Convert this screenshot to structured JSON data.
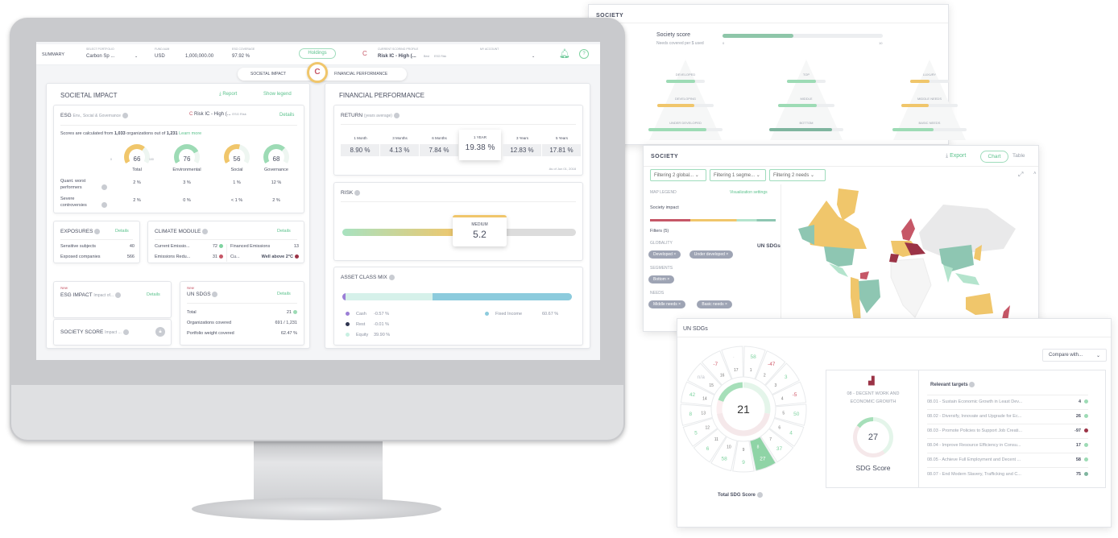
{
  "colors": {
    "accent": "#5cc28d",
    "yellow": "#f0c66b",
    "red": "#c65767",
    "darkred": "#9b3346",
    "teal": "#8ec6b2",
    "blue": "#8ccbdd"
  },
  "header": {
    "summary": "SUMMARY",
    "portfolio_label": "SELECT PORTFOLIO",
    "portfolio_value": "Carbon Sp ...",
    "aum_label": "FUND AUM",
    "aum_currency": "USD",
    "aum_value": "1,000,000.00",
    "coverage_label": "ESG COVERAGE",
    "coverage_value": "97.92 %",
    "holdings": "Holdings",
    "profile_label": "CURRENT SCORING PROFILE",
    "profile_value": "Risk IC - High (...",
    "profile_tag1": "Best",
    "profile_tag2": "ESG Risk",
    "account_label": "MY ACCOUNT"
  },
  "toggle": {
    "left": "SOCIETAL IMPACT",
    "right": "FINANCIAL PERFORMANCE",
    "logo": "C"
  },
  "societal": {
    "title": "SOCIETAL IMPACT",
    "report": "Report",
    "legend": "Show legend",
    "esg": {
      "title": "ESG",
      "subtitle": "Env., Social & Governance",
      "profile": "Risk IC - High (...",
      "tag": "ESG Risk",
      "details": "Details",
      "note_pre": "Scores are calculated from ",
      "note_n": "1,033",
      "note_mid": " organizations out of ",
      "note_total": "1,231",
      "learn": "Learn more",
      "gauges": [
        {
          "label": "Total",
          "value": 66,
          "min": "0",
          "max": "100",
          "color": "#f0c66b"
        },
        {
          "label": "Environmental",
          "value": 76,
          "color": "#9ddbb5"
        },
        {
          "label": "Social",
          "value": 56,
          "color": "#f0c66b"
        },
        {
          "label": "Governance",
          "value": 68,
          "color": "#9ddbb5"
        }
      ],
      "rows": [
        {
          "label1": "Quant. worst",
          "label2": "performers",
          "values": [
            "2 %",
            "3 %",
            "1 %",
            "12 %"
          ]
        },
        {
          "label1": "Severe",
          "label2": "controversies",
          "values": [
            "2 %",
            "0 %",
            "< 1 %",
            "2 %"
          ]
        }
      ]
    },
    "exposures": {
      "title": "EXPOSURES",
      "details": "Details",
      "rows": [
        {
          "label": "Sensitive subjects",
          "value": "40"
        },
        {
          "label": "Exposed companies",
          "value": "566"
        }
      ]
    },
    "climate": {
      "title": "CLIMATE MODULE",
      "details": "Details",
      "rows": [
        {
          "label": "Current Emissio...",
          "value": "72",
          "dot": "#7fd3a0"
        },
        {
          "label": "Emissions Redu...",
          "value": "31",
          "dot": "#c65767"
        }
      ],
      "rows2": [
        {
          "label": "Financed Emissions",
          "value": "13"
        },
        {
          "label": "Cu...",
          "value": "Well above 2°C",
          "dot": "#9b3346"
        }
      ]
    },
    "esg_impact": {
      "new": "New",
      "title": "ESG IMPACT",
      "subtitle": "Impact of...",
      "details": "Details"
    },
    "society_score": {
      "title": "SOCIETY SCORE",
      "subtitle": "Impact ..."
    },
    "un_sdgs": {
      "new": "New",
      "title": "UN SDGS",
      "details": "Details",
      "rows": [
        {
          "label": "Total",
          "value": "21"
        },
        {
          "label": "Organizations covered",
          "value": "691 / 1,231"
        },
        {
          "label": "Portfolio weight covered",
          "value": "62.47 %"
        }
      ]
    }
  },
  "financial": {
    "title": "FINANCIAL PERFORMANCE",
    "return": {
      "title": "RETURN",
      "subtitle": "(years average)",
      "periods": [
        {
          "label": "1 Month",
          "value": "8.90 %"
        },
        {
          "label": "3 Months",
          "value": "4.13 %"
        },
        {
          "label": "6 Months",
          "value": "7.84 %"
        },
        {
          "label": "1 YEAR",
          "value": "19.38 %",
          "selected": true
        },
        {
          "label": "3 Years",
          "value": "12.83 %"
        },
        {
          "label": "5 Years",
          "value": "17.81 %"
        }
      ],
      "asof": "As of Jun 01, 2018"
    },
    "risk": {
      "title": "RISK",
      "level": "MEDIUM",
      "value": "5.2"
    },
    "asset_mix": {
      "title": "ASSET CLASS MIX",
      "items": [
        {
          "label": "Cash",
          "value": "-0.57 %",
          "color": "#9b7fd6"
        },
        {
          "label": "Rest",
          "value": "-0.01 %",
          "color": "#2f3550"
        },
        {
          "label": "Equity",
          "value": "39.90 %",
          "color": "#c8f0e2"
        },
        {
          "label": "Fixed Income",
          "value": "60.67 %",
          "color": "#8ccbdd"
        }
      ],
      "equity_pct": 39.9,
      "fixed_pct": 60.67
    }
  },
  "society_back": {
    "title": "SOCIETY",
    "score_label": "Society score",
    "score_sub": "Needs covered per $ used",
    "score_min": "0",
    "score_max": "10",
    "score_value": 4.4,
    "pyramids": [
      [
        {
          "label": "DEVELOPED",
          "pct": 75,
          "color": "#9ddbb5"
        },
        {
          "label": "DEVELOPING",
          "pct": 65,
          "color": "#f0c66b"
        },
        {
          "label": "UNDER DEVELOPED",
          "pct": 78,
          "color": "#9ddbb5"
        }
      ],
      [
        {
          "label": "TOP",
          "pct": 75,
          "color": "#9ddbb5"
        },
        {
          "label": "MIDDLE",
          "pct": 68,
          "color": "#9ddbb5"
        },
        {
          "label": "BOTTOM",
          "pct": 85,
          "color": "#7fb59f"
        }
      ],
      [
        {
          "label": "LUXURY",
          "pct": 50,
          "color": "#f0c66b"
        },
        {
          "label": "MIDDLE NEEDS",
          "pct": 48,
          "color": "#f0c66b"
        },
        {
          "label": "BASIC NEEDS",
          "pct": 55,
          "color": "#9ddbb5"
        }
      ]
    ]
  },
  "society_map": {
    "title": "SOCIETY",
    "export": "Export",
    "tab_chart": "Chart",
    "tab_table": "Table",
    "filters": [
      "Filtering 2 global...",
      "Filtering 1 segme...",
      "Filtering 2 needs"
    ],
    "legend_title": "MAP LEGEND",
    "viz": "Visualization settings",
    "impact": "Society impact",
    "filters_label": "Filters (5)",
    "groups": [
      {
        "name": "GLOBALITY",
        "chips": [
          "Developed",
          "Under developed"
        ]
      },
      {
        "name": "SEGMENTS",
        "chips": [
          "Bottom"
        ]
      },
      {
        "name": "NEEDS",
        "chips": [
          "Middle needs",
          "Basic needs"
        ]
      }
    ],
    "overlay": "UN SDGs"
  },
  "sdg": {
    "title": "UN SDGs",
    "total": "21",
    "total_label": "Total SDG Score",
    "compare": "Compare with...",
    "segments": [
      {
        "n": "1",
        "s": "58"
      },
      {
        "n": "2",
        "s": "-47"
      },
      {
        "n": "3",
        "s": "3"
      },
      {
        "n": "4",
        "s": "-5"
      },
      {
        "n": "5",
        "s": "50"
      },
      {
        "n": "6",
        "s": "4"
      },
      {
        "n": "7",
        "s": "37"
      },
      {
        "n": "8",
        "s": "27"
      },
      {
        "n": "9",
        "s": "9"
      },
      {
        "n": "10",
        "s": "58"
      },
      {
        "n": "11",
        "s": "6"
      },
      {
        "n": "12",
        "s": "5"
      },
      {
        "n": "13",
        "s": "8"
      },
      {
        "n": "14",
        "s": "42"
      },
      {
        "n": "15",
        "s": "n/a"
      },
      {
        "n": "16",
        "s": "-7"
      },
      {
        "n": "17",
        "s": "·"
      }
    ],
    "selected": {
      "title1": "08 - DECENT WORK AND",
      "title2": "ECONOMIC GROWTH",
      "score": "27",
      "label": "SDG Score"
    },
    "targets_title": "Relevant targets",
    "targets": [
      {
        "label": "08.01 - Sustain Economic Growth in Least Dev...",
        "value": "4",
        "dot": "#9ddbb5"
      },
      {
        "label": "08.02 - Diversify, Innovate and Upgrade for Ec...",
        "value": "26",
        "dot": "#9ddbb5"
      },
      {
        "label": "08.03 - Promote Policies to Support Job Creati...",
        "value": "-97",
        "dot": "#9b3346"
      },
      {
        "label": "08.04 - Improve Resource Efficiency in Consu...",
        "value": "17",
        "dot": "#9ddbb5"
      },
      {
        "label": "08.05 - Achieve Full Employment and Decent ...",
        "value": "58",
        "dot": "#9ddbb5"
      },
      {
        "label": "08.07 - End Modern Slavery, Trafficking and C...",
        "value": "75",
        "dot": "#7fb59f"
      }
    ]
  }
}
